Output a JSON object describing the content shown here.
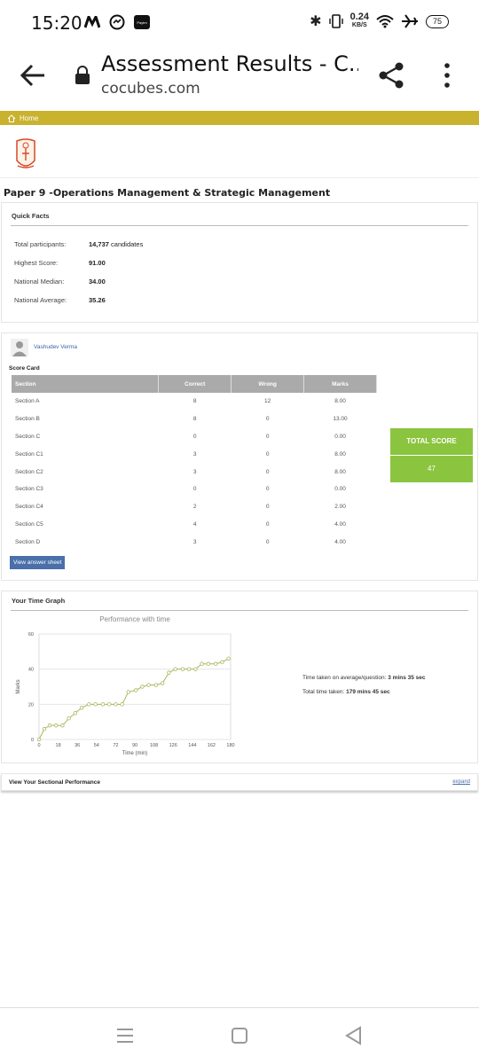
{
  "status": {
    "time": "15:20",
    "net_speed": "0.24",
    "net_unit": "KB/S",
    "battery": "75",
    "paytm": "Paytm"
  },
  "browser": {
    "title": "Assessment Results - C...",
    "url": "cocubes.com"
  },
  "home": {
    "label": "Home"
  },
  "paper_title": "Paper 9 -Operations Management & Strategic Management",
  "quick_facts": {
    "heading": "Quick Facts",
    "rows": [
      {
        "label": "Total participants:",
        "value": "14,737",
        "suffix": " candidates"
      },
      {
        "label": "Highest Score:",
        "value": "91.00",
        "suffix": ""
      },
      {
        "label": "National Median:",
        "value": "34.00",
        "suffix": ""
      },
      {
        "label": "National Average:",
        "value": "35.26",
        "suffix": ""
      }
    ]
  },
  "user": {
    "name": "Vashudev Verma"
  },
  "scorecard": {
    "label": "Score Card",
    "headers": [
      "Section",
      "Correct",
      "Wrong",
      "Marks"
    ],
    "rows": [
      [
        "Section A",
        "8",
        "12",
        "8.00"
      ],
      [
        "Section B",
        "8",
        "0",
        "13.00"
      ],
      [
        "Section C",
        "0",
        "0",
        "0.00"
      ],
      [
        "Section C1",
        "3",
        "0",
        "8.00"
      ],
      [
        "Section C2",
        "3",
        "0",
        "8.00"
      ],
      [
        "Section C3",
        "0",
        "0",
        "0.00"
      ],
      [
        "Section C4",
        "2",
        "0",
        "2.00"
      ],
      [
        "Section C5",
        "4",
        "0",
        "4.00"
      ],
      [
        "Section D",
        "3",
        "0",
        "4.00"
      ]
    ],
    "total_label": "TOTAL SCORE",
    "total_value": "47",
    "view_answer": "View answer sheet"
  },
  "time_graph": {
    "heading": "Your Time Graph",
    "avg_label": "Time taken on average/question:",
    "avg_value": "3 mins 35 sec",
    "total_label": "Total time taken:",
    "total_value": "179 mins 45 sec"
  },
  "sectional": {
    "heading": "View Your Sectional Performance",
    "expand": "expand"
  },
  "chart_data": {
    "type": "line",
    "title": "Performance with time",
    "xlabel": "Time (min)",
    "ylabel": "Marks",
    "xlim": [
      0,
      180
    ],
    "ylim": [
      0,
      60
    ],
    "x_ticks": [
      "0",
      "18",
      "36",
      "54",
      "72",
      "90",
      "108",
      "126",
      "144",
      "162",
      "180"
    ],
    "y_ticks": [
      "0",
      "20",
      "40",
      "60"
    ],
    "grid": true,
    "color": "#a8b85c",
    "series": [
      {
        "x": [
          0,
          5,
          10,
          16,
          22,
          28,
          34,
          40,
          47,
          53,
          60,
          66,
          72,
          78,
          84,
          91,
          97,
          103,
          110,
          116,
          122,
          128,
          135,
          141,
          147,
          153,
          159,
          166,
          172,
          178
        ],
        "y": [
          0,
          6,
          8,
          8,
          8,
          12,
          15,
          18,
          20,
          20,
          20,
          20,
          20,
          20,
          27,
          28,
          30,
          31,
          31,
          32,
          38,
          40,
          40,
          40,
          40,
          43,
          43,
          43,
          44,
          46
        ]
      }
    ]
  }
}
